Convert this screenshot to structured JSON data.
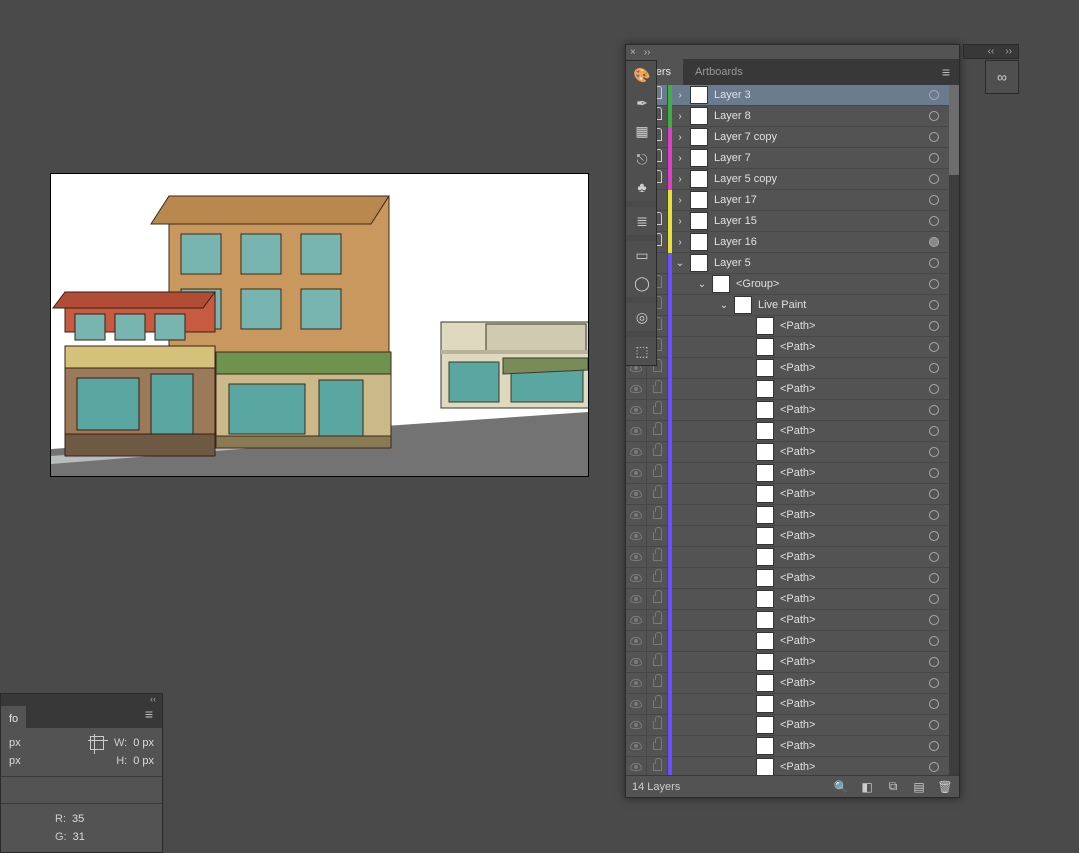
{
  "panel": {
    "tabs": {
      "layers": "Layers",
      "artboards": "Artboards"
    },
    "footer_text": "14 Layers"
  },
  "layers": [
    {
      "name": "Layer 3",
      "depth": 0,
      "color": "#3cb043",
      "visible": true,
      "vDim": false,
      "locked": true,
      "disc": "›",
      "selected": true,
      "targetFilled": false
    },
    {
      "name": "Layer 8",
      "depth": 0,
      "color": "#3cb043",
      "visible": false,
      "vDim": false,
      "locked": true,
      "disc": "›",
      "targetFilled": false
    },
    {
      "name": "Layer 7 copy",
      "depth": 0,
      "color": "#e23ccf",
      "visible": false,
      "vDim": false,
      "locked": true,
      "disc": "›",
      "targetFilled": false
    },
    {
      "name": "Layer 7",
      "depth": 0,
      "color": "#e23ccf",
      "visible": false,
      "vDim": false,
      "locked": true,
      "disc": "›",
      "targetFilled": false
    },
    {
      "name": "Layer 5 copy",
      "depth": 0,
      "color": "#e23ccf",
      "visible": false,
      "vDim": false,
      "locked": true,
      "disc": "›",
      "targetFilled": false
    },
    {
      "name": "Layer 17",
      "depth": 0,
      "color": "#e9e03a",
      "visible": false,
      "vDim": false,
      "locked": false,
      "disc": "›",
      "targetFilled": false
    },
    {
      "name": "Layer 15",
      "depth": 0,
      "color": "#e9e03a",
      "visible": false,
      "vDim": false,
      "locked": true,
      "disc": "›",
      "targetFilled": false
    },
    {
      "name": "Layer 16",
      "depth": 0,
      "color": "#e9e03a",
      "visible": false,
      "vDim": false,
      "locked": true,
      "disc": "›",
      "targetFilled": true
    },
    {
      "name": "Layer 5",
      "depth": 0,
      "color": "#6a4fff",
      "visible": true,
      "vDim": false,
      "locked": false,
      "disc": "⌄",
      "targetFilled": false
    },
    {
      "name": "<Group>",
      "depth": 1,
      "color": "#6a4fff",
      "visible": true,
      "vDim": true,
      "locked": true,
      "lockDim": true,
      "disc": "⌄",
      "targetFilled": false
    },
    {
      "name": "Live Paint",
      "depth": 2,
      "color": "#6a4fff",
      "visible": true,
      "vDim": true,
      "locked": true,
      "lockDim": true,
      "disc": "⌄",
      "targetFilled": false
    },
    {
      "name": "<Path>",
      "depth": 3,
      "color": "#6a4fff",
      "visible": true,
      "vDim": true,
      "locked": true,
      "lockDim": true,
      "disc": "",
      "targetFilled": false
    },
    {
      "name": "<Path>",
      "depth": 3,
      "color": "#6a4fff",
      "visible": true,
      "vDim": true,
      "locked": true,
      "lockDim": true,
      "disc": "",
      "targetFilled": false
    },
    {
      "name": "<Path>",
      "depth": 3,
      "color": "#6a4fff",
      "visible": true,
      "vDim": true,
      "locked": true,
      "lockDim": true,
      "disc": "",
      "targetFilled": false
    },
    {
      "name": "<Path>",
      "depth": 3,
      "color": "#6a4fff",
      "visible": true,
      "vDim": true,
      "locked": true,
      "lockDim": true,
      "disc": "",
      "targetFilled": false
    },
    {
      "name": "<Path>",
      "depth": 3,
      "color": "#6a4fff",
      "visible": true,
      "vDim": true,
      "locked": true,
      "lockDim": true,
      "disc": "",
      "targetFilled": false
    },
    {
      "name": "<Path>",
      "depth": 3,
      "color": "#6a4fff",
      "visible": true,
      "vDim": true,
      "locked": true,
      "lockDim": true,
      "disc": "",
      "targetFilled": false
    },
    {
      "name": "<Path>",
      "depth": 3,
      "color": "#6a4fff",
      "visible": true,
      "vDim": true,
      "locked": true,
      "lockDim": true,
      "disc": "",
      "targetFilled": false
    },
    {
      "name": "<Path>",
      "depth": 3,
      "color": "#6a4fff",
      "visible": true,
      "vDim": true,
      "locked": true,
      "lockDim": true,
      "disc": "",
      "targetFilled": false
    },
    {
      "name": "<Path>",
      "depth": 3,
      "color": "#6a4fff",
      "visible": true,
      "vDim": true,
      "locked": true,
      "lockDim": true,
      "disc": "",
      "targetFilled": false
    },
    {
      "name": "<Path>",
      "depth": 3,
      "color": "#6a4fff",
      "visible": true,
      "vDim": true,
      "locked": true,
      "lockDim": true,
      "disc": "",
      "targetFilled": false
    },
    {
      "name": "<Path>",
      "depth": 3,
      "color": "#6a4fff",
      "visible": true,
      "vDim": true,
      "locked": true,
      "lockDim": true,
      "disc": "",
      "targetFilled": false
    },
    {
      "name": "<Path>",
      "depth": 3,
      "color": "#6a4fff",
      "visible": true,
      "vDim": true,
      "locked": true,
      "lockDim": true,
      "disc": "",
      "targetFilled": false
    },
    {
      "name": "<Path>",
      "depth": 3,
      "color": "#6a4fff",
      "visible": true,
      "vDim": true,
      "locked": true,
      "lockDim": true,
      "disc": "",
      "targetFilled": false
    },
    {
      "name": "<Path>",
      "depth": 3,
      "color": "#6a4fff",
      "visible": true,
      "vDim": true,
      "locked": true,
      "lockDim": true,
      "disc": "",
      "targetFilled": false
    },
    {
      "name": "<Path>",
      "depth": 3,
      "color": "#6a4fff",
      "visible": true,
      "vDim": true,
      "locked": true,
      "lockDim": true,
      "disc": "",
      "targetFilled": false
    },
    {
      "name": "<Path>",
      "depth": 3,
      "color": "#6a4fff",
      "visible": true,
      "vDim": true,
      "locked": true,
      "lockDim": true,
      "disc": "",
      "targetFilled": false
    },
    {
      "name": "<Path>",
      "depth": 3,
      "color": "#6a4fff",
      "visible": true,
      "vDim": true,
      "locked": true,
      "lockDim": true,
      "disc": "",
      "targetFilled": false
    },
    {
      "name": "<Path>",
      "depth": 3,
      "color": "#6a4fff",
      "visible": true,
      "vDim": true,
      "locked": true,
      "lockDim": true,
      "disc": "",
      "targetFilled": false
    },
    {
      "name": "<Path>",
      "depth": 3,
      "color": "#6a4fff",
      "visible": true,
      "vDim": true,
      "locked": true,
      "lockDim": true,
      "disc": "",
      "targetFilled": false
    },
    {
      "name": "<Path>",
      "depth": 3,
      "color": "#6a4fff",
      "visible": true,
      "vDim": true,
      "locked": true,
      "lockDim": true,
      "disc": "",
      "targetFilled": false
    },
    {
      "name": "<Path>",
      "depth": 3,
      "color": "#6a4fff",
      "visible": true,
      "vDim": true,
      "locked": true,
      "lockDim": true,
      "disc": "",
      "targetFilled": false
    },
    {
      "name": "<Path>",
      "depth": 3,
      "color": "#6a4fff",
      "visible": true,
      "vDim": true,
      "locked": true,
      "lockDim": true,
      "disc": "",
      "targetFilled": false
    }
  ],
  "info": {
    "tab": "fo",
    "x_suffix": "px",
    "y_suffix": "px",
    "w_label": "W:",
    "h_label": "H:",
    "w_value": "0 px",
    "h_value": "0 px",
    "r_label": "R:",
    "r_value": "35",
    "g_label": "G:",
    "g_value": "31"
  },
  "dock": {
    "items": [
      "palette",
      "brush",
      "swatch",
      "fork",
      "clover",
      "sep",
      "lines",
      "sep",
      "rect",
      "circle",
      "sep",
      "target",
      "sep",
      "shapes"
    ]
  }
}
